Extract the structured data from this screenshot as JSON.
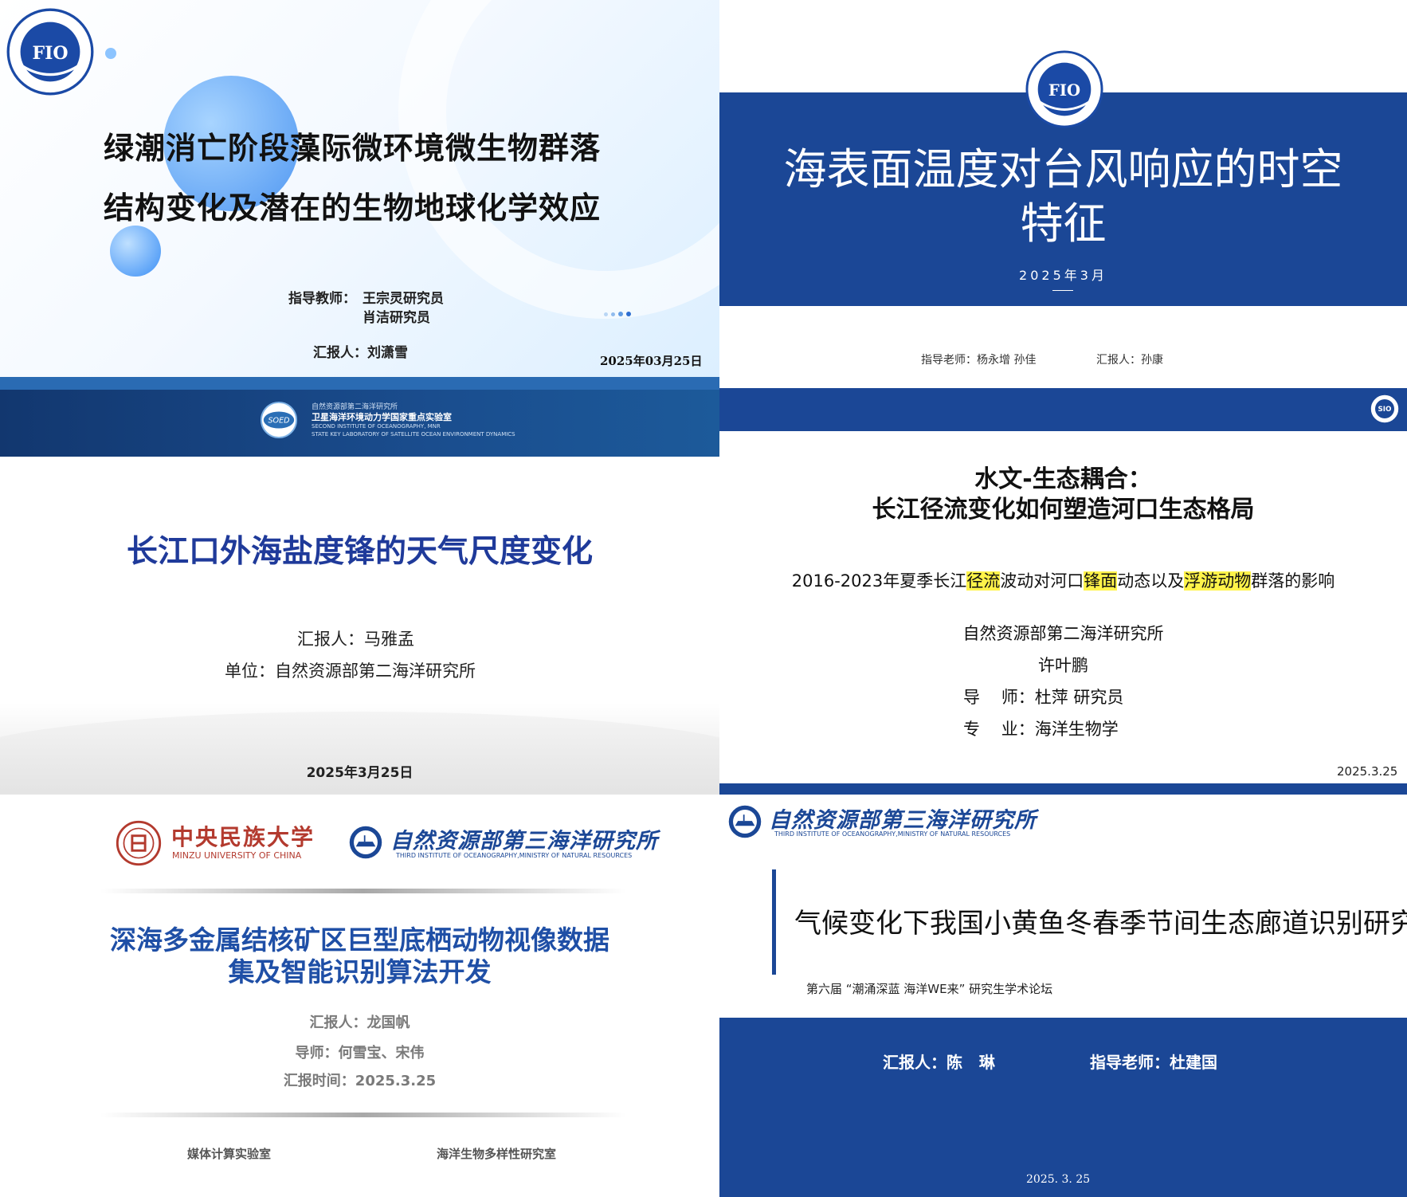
{
  "slide1": {
    "logo_text": "FIO",
    "title_line1": "绿潮消亡阶段藻际微环境微生物群落",
    "title_line2": "结构变化及潜在的生物地球化学效应",
    "advisor_label": "指导教师：",
    "advisor1": "王宗灵研究员",
    "advisor2": "肖洁研究员",
    "reporter": "汇报人：刘潇雪",
    "date": "2025年03月25日"
  },
  "slide2": {
    "logo_text": "FIO",
    "title_line1": "海表面温度对台风响应的时空",
    "title_line2": "特征",
    "date": "2025年3月",
    "advisor": "指导老师：杨永增  孙佳",
    "reporter": "汇报人：孙康"
  },
  "slide3": {
    "lab_logo": "SOED",
    "lab_line1": "自然资源部第二海洋研究所",
    "lab_line2": "卫星海洋环境动力学国家重点实验室",
    "lab_line3": "SECOND INSTITUTE OF OCEANOGRAPHY, MNR",
    "lab_line4": "STATE KEY LABORATORY OF SATELLITE OCEAN ENVIRONMENT DYNAMICS",
    "title": "长江口外海盐度锋的天气尺度变化",
    "reporter": "汇报人：马雅孟",
    "unit": "单位：自然资源部第二海洋研究所",
    "date": "2025年3月25日"
  },
  "slide4": {
    "logo_text": "SIO",
    "title_line1": "水文-生态耦合：",
    "title_line2": "长江径流变化如何塑造河口生态格局",
    "subtitle_a": "2016-2023年夏季长江",
    "subtitle_hl1": "径流",
    "subtitle_b": "波动对河口",
    "subtitle_hl2": "锋面",
    "subtitle_c": "动态以及",
    "subtitle_hl3": "浮游动物",
    "subtitle_d": "群落的影响",
    "institute": "自然资源部第二海洋研究所",
    "name": "许叶鹏",
    "advisor": "导    师：杜萍 研究员",
    "major": "专    业：海洋生物学",
    "date": "2025.3.25"
  },
  "slide5": {
    "minzu_cn": "中央民族大学",
    "minzu_en": "MINZU UNIVERSITY OF CHINA",
    "tio_cn": "自然资源部第三海洋研究所",
    "tio_en": "THIRD INSTITUTE OF OCEANOGRAPHY,MINISTRY OF NATURAL RESOURCES",
    "title_line1": "深海多金属结核矿区巨型底栖动物视像数据",
    "title_line2": "集及智能识别算法开发",
    "reporter": "汇报人：龙国帆",
    "advisor": "导师：何雪宝、宋伟",
    "time": "汇报时间：2025.3.25",
    "lab1": "媒体计算实验室",
    "lab2": "海洋生物多样性研究室"
  },
  "slide6": {
    "tio_cn": "自然资源部第三海洋研究所",
    "tio_en": "THIRD INSTITUTE OF OCEANOGRAPHY,MINISTRY OF NATURAL RESOURCES",
    "title": "气候变化下我国小黄鱼冬春季节间生态廊道识别研究",
    "forum": "第六届 “潮涌深蓝 海洋WE来” 研究生学术论坛",
    "reporter": "汇报人：陈   琳",
    "advisor": "指导老师：杜建国",
    "date": "2025. 3. 25"
  }
}
